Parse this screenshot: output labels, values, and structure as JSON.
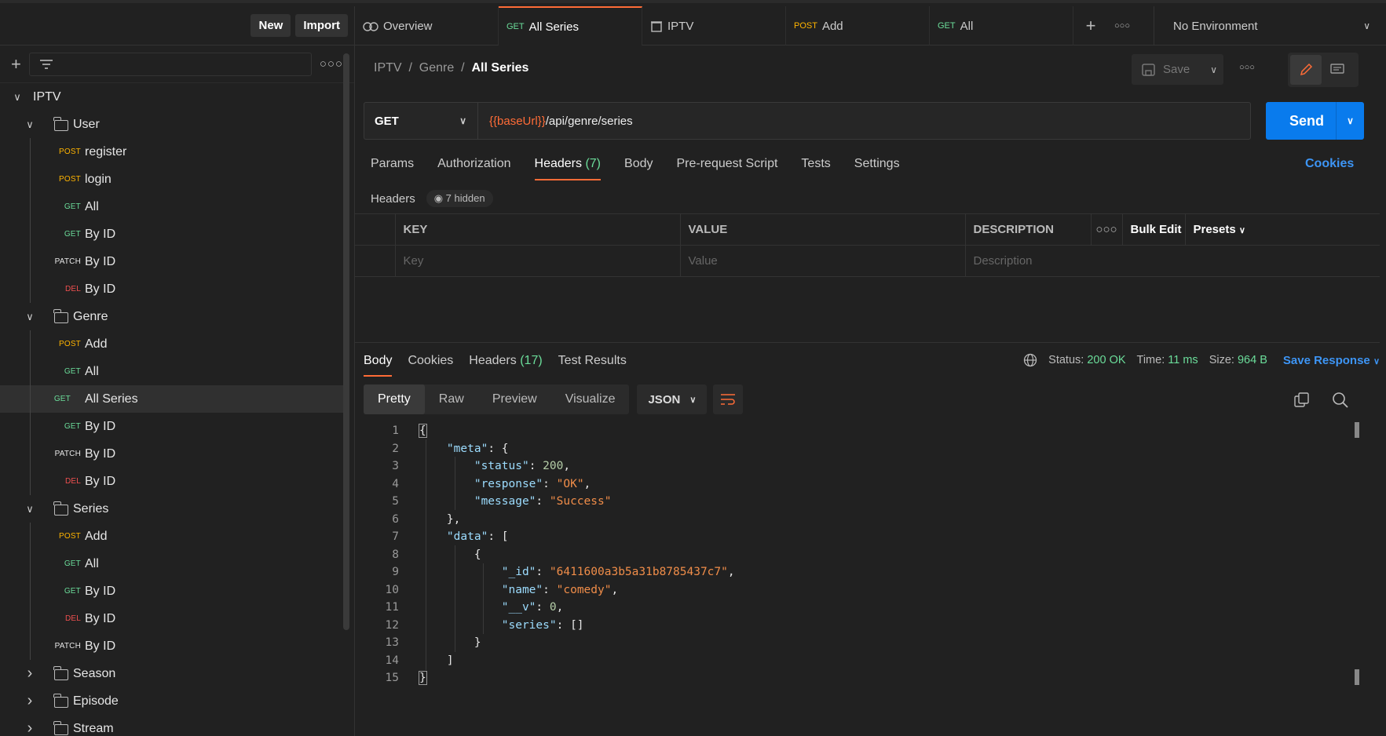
{
  "sidebar": {
    "new_label": "New",
    "import_label": "Import",
    "tree": [
      {
        "type": "collection",
        "label": "IPTV",
        "expanded": true
      },
      {
        "type": "folder",
        "label": "User",
        "expanded": true
      },
      {
        "type": "request",
        "method": "POST",
        "label": "register"
      },
      {
        "type": "request",
        "method": "POST",
        "label": "login"
      },
      {
        "type": "request",
        "method": "GET",
        "label": "All"
      },
      {
        "type": "request",
        "method": "GET",
        "label": "By ID"
      },
      {
        "type": "request",
        "method": "PATCH",
        "label": "By ID"
      },
      {
        "type": "request",
        "method": "DEL",
        "label": "By ID"
      },
      {
        "type": "folder",
        "label": "Genre",
        "expanded": true
      },
      {
        "type": "request",
        "method": "POST",
        "label": "Add"
      },
      {
        "type": "request",
        "method": "GET",
        "label": "All"
      },
      {
        "type": "request",
        "method": "GET",
        "label": "All Series",
        "selected": true
      },
      {
        "type": "request",
        "method": "GET",
        "label": "By ID"
      },
      {
        "type": "request",
        "method": "PATCH",
        "label": "By ID"
      },
      {
        "type": "request",
        "method": "DEL",
        "label": "By ID"
      },
      {
        "type": "folder",
        "label": "Series",
        "expanded": true
      },
      {
        "type": "request",
        "method": "POST",
        "label": "Add"
      },
      {
        "type": "request",
        "method": "GET",
        "label": "All"
      },
      {
        "type": "request",
        "method": "GET",
        "label": "By ID"
      },
      {
        "type": "request",
        "method": "DEL",
        "label": "By ID"
      },
      {
        "type": "request",
        "method": "PATCH",
        "label": "By ID"
      },
      {
        "type": "folder",
        "label": "Season",
        "expanded": false
      },
      {
        "type": "folder",
        "label": "Episode",
        "expanded": false
      },
      {
        "type": "folder",
        "label": "Stream",
        "expanded": false
      }
    ]
  },
  "tabs": [
    {
      "label": "Overview",
      "icon": "overview-icon"
    },
    {
      "method": "GET",
      "label": "All Series",
      "active": true
    },
    {
      "label": "IPTV",
      "icon": "collection-icon"
    },
    {
      "method": "POST",
      "label": "Add"
    },
    {
      "method": "GET",
      "label": "All"
    }
  ],
  "environment": "No Environment",
  "breadcrumb": {
    "p1": "IPTV",
    "p2": "Genre",
    "p3": "All Series",
    "sep": "/"
  },
  "save_label": "Save",
  "request": {
    "method": "GET",
    "url_var": "{{baseUrl}}",
    "url_path": "/api/genre/series",
    "send_label": "Send"
  },
  "req_tabs": {
    "params": "Params",
    "authorization": "Authorization",
    "headers": "Headers",
    "headers_count": "(7)",
    "body": "Body",
    "prerequest": "Pre-request Script",
    "tests": "Tests",
    "settings": "Settings",
    "cookies": "Cookies"
  },
  "headers_section": {
    "label": "Headers",
    "hidden": "7 hidden"
  },
  "kv_table": {
    "key": "KEY",
    "value": "VALUE",
    "description": "DESCRIPTION",
    "bulk_edit": "Bulk Edit",
    "presets": "Presets",
    "key_ph": "Key",
    "value_ph": "Value",
    "desc_ph": "Description"
  },
  "response": {
    "tabs": {
      "body": "Body",
      "cookies": "Cookies",
      "headers": "Headers",
      "headers_count": "(17)",
      "test_results": "Test Results"
    },
    "status_label": "Status:",
    "status": "200 OK",
    "time_label": "Time:",
    "time": "11 ms",
    "size_label": "Size:",
    "size": "964 B",
    "save_response": "Save Response"
  },
  "view": {
    "pretty": "Pretty",
    "raw": "Raw",
    "preview": "Preview",
    "visualize": "Visualize",
    "format": "JSON"
  },
  "code_lines": [
    "1",
    "2",
    "3",
    "4",
    "5",
    "6",
    "7",
    "8",
    "9",
    "10",
    "11",
    "12",
    "13",
    "14",
    "15"
  ],
  "json_body": {
    "l2k": "\"meta\"",
    "l3k": "\"status\"",
    "l3v": "200",
    "l4k": "\"response\"",
    "l4v": "\"OK\"",
    "l5k": "\"message\"",
    "l5v": "\"Success\"",
    "l7k": "\"data\"",
    "l9k": "\"_id\"",
    "l9v": "\"6411600a3b5a31b8785437c7\"",
    "l10k": "\"name\"",
    "l10v": "\"comedy\"",
    "l11k": "\"__v\"",
    "l11v": "0",
    "l12k": "\"series\"",
    "l12v": "[]"
  }
}
